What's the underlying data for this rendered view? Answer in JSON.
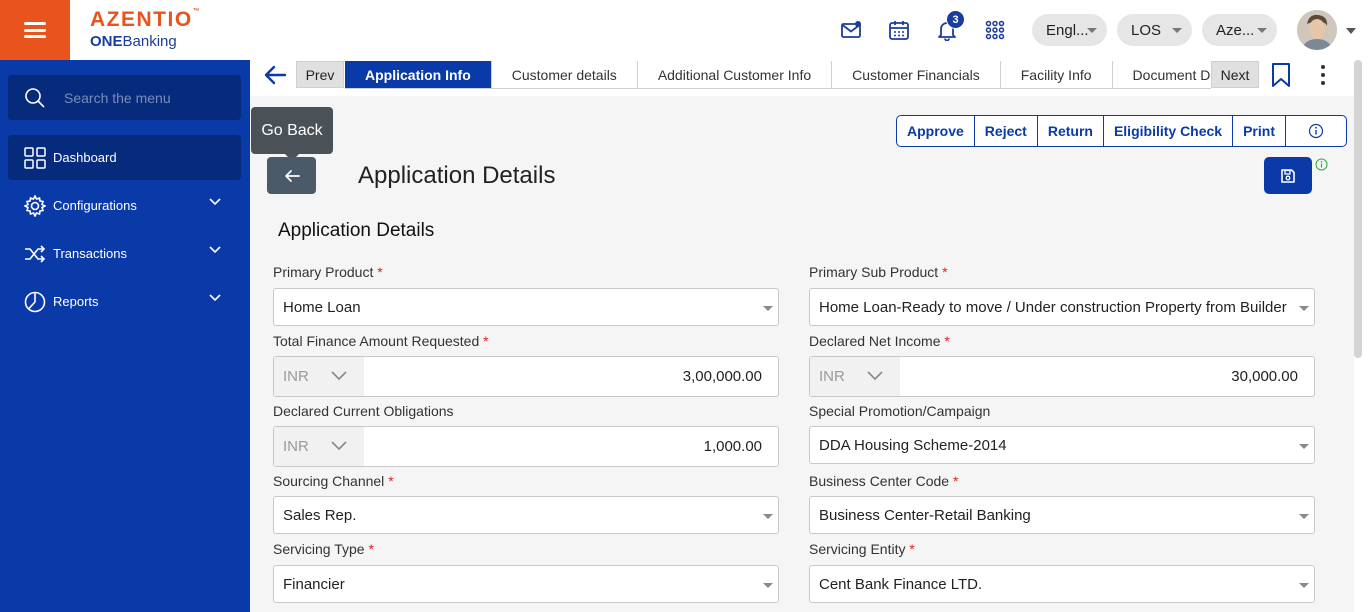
{
  "header": {
    "logo_main": "AZENTIO",
    "logo_tm": "™",
    "logo_sub_bold": "ONE",
    "logo_sub_rest": "Banking",
    "notification_count": "3",
    "language": "Engl...",
    "module": "LOS",
    "entity": "Aze...",
    "icons": [
      "menu-icon",
      "mail-icon",
      "calendar-icon",
      "bell-icon",
      "apps-grid-icon"
    ]
  },
  "sidebar": {
    "search_placeholder": "Search the menu",
    "items": [
      {
        "label": "Dashboard",
        "icon": "dashboard-icon",
        "active": true
      },
      {
        "label": "Configurations",
        "icon": "gear-icon"
      },
      {
        "label": "Transactions",
        "icon": "shuffle-icon"
      },
      {
        "label": "Reports",
        "icon": "pie-chart-icon"
      }
    ]
  },
  "tabs": {
    "prev_label": "Prev",
    "next_label": "Next",
    "items": [
      "Application Info",
      "Customer details",
      "Additional Customer Info",
      "Customer Financials",
      "Facility Info",
      "Document Details"
    ],
    "active_index": 0
  },
  "toolbar": {
    "go_back_tooltip": "Go Back",
    "page_title": "Application Details",
    "actions": [
      "Approve",
      "Reject",
      "Return",
      "Eligibility Check",
      "Print"
    ]
  },
  "form": {
    "section_title": "Application Details",
    "primary_product": {
      "label": "Primary Product",
      "required": "*",
      "value": "Home Loan"
    },
    "primary_sub_product": {
      "label": "Primary Sub Product",
      "required": "*",
      "value": "Home Loan-Ready to move / Under construction Property from Builder"
    },
    "total_finance": {
      "label": "Total Finance Amount Requested",
      "required": "*",
      "currency": "INR",
      "value": "3,00,000.00"
    },
    "declared_net_income": {
      "label": "Declared Net Income",
      "required": "*",
      "currency": "INR",
      "value": "30,000.00"
    },
    "declared_obligations": {
      "label": "Declared Current Obligations",
      "currency": "INR",
      "value": "1,000.00"
    },
    "special_promotion": {
      "label": "Special Promotion/Campaign",
      "value": "DDA Housing Scheme-2014"
    },
    "sourcing_channel": {
      "label": "Sourcing Channel",
      "required": "*",
      "value": "Sales Rep."
    },
    "business_center_code": {
      "label": "Business Center Code",
      "required": "*",
      "value": "Business Center-Retail Banking"
    },
    "servicing_type": {
      "label": "Servicing Type",
      "required": "*",
      "value": "Financier"
    },
    "servicing_entity": {
      "label": "Servicing Entity",
      "required": "*",
      "value": "Cent Bank Finance LTD."
    }
  },
  "colors": {
    "brand_orange": "#e8541c",
    "brand_blue": "#0a3aa8",
    "required": "#e02020"
  }
}
